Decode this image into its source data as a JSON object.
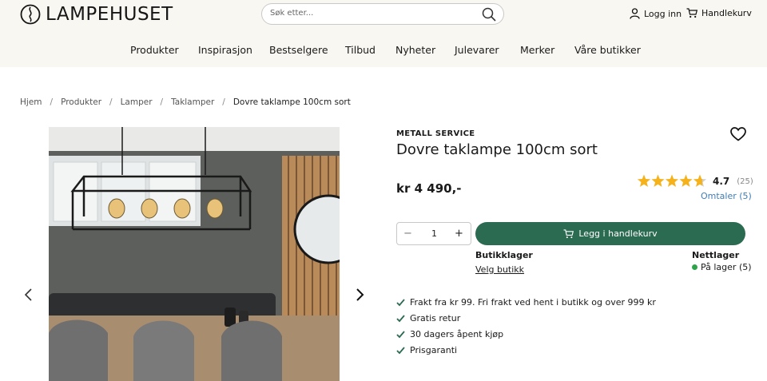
{
  "header": {
    "logo_text": "LAMPEHUSET",
    "search": {
      "placeholder": "Søk etter..."
    },
    "login_label": "Logg inn",
    "cart_label": "Handlekurv"
  },
  "nav": {
    "items": [
      "Produkter",
      "Inspirasjon",
      "Bestselgere",
      "Tilbud",
      "Nyheter",
      "Julevarer",
      "Merker",
      "Våre butikker"
    ]
  },
  "breadcrumb": [
    "Hjem",
    "Produkter",
    "Lamper",
    "Taklamper",
    "Dovre taklampe 100cm sort"
  ],
  "product": {
    "brand": "METALL SERVICE",
    "title": "Dovre taklampe 100cm sort",
    "price": "kr 4 490,-",
    "rating": "4.7",
    "rating_value": 4.7,
    "rating_max": 5,
    "rating_count": "(25)",
    "reviews_link": "Omtaler (5)",
    "quantity": "1",
    "add_to_cart_label": "Legg i handlekurv",
    "store_stock_heading": "Butikklager",
    "store_stock_link": "Velg butikk",
    "online_stock_heading": "Nettlager",
    "online_stock_status": "På lager (5)",
    "usps": [
      "Frakt fra kr 99. Fri frakt ved hent i butikk og over 999 kr",
      "Gratis retur",
      "30 dagers åpent kjøp",
      "Prisgaranti"
    ]
  },
  "colors": {
    "accent_green": "#2b6b52",
    "topbar_bg": "#f9f7f2",
    "star": "#f5b21b",
    "link": "#3f7eb8"
  }
}
